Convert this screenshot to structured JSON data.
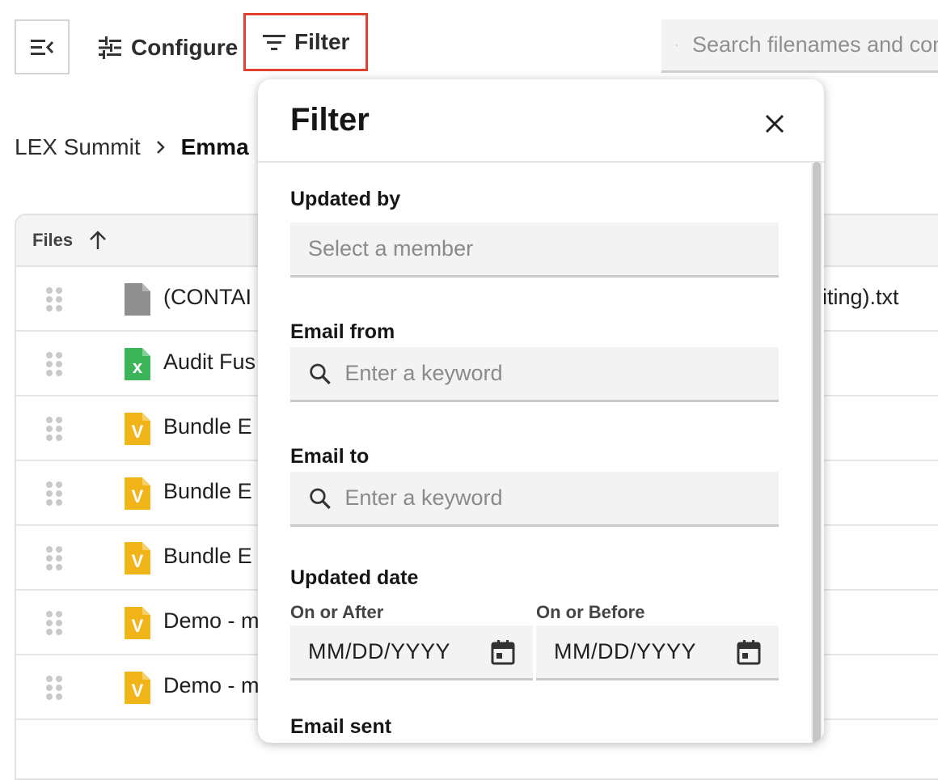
{
  "toolbar": {
    "configure_label": "Configure",
    "filter_label": "Filter",
    "search_placeholder": "Search filenames and content"
  },
  "breadcrumb": {
    "root": "LEX Summit",
    "current": "Emma"
  },
  "table": {
    "header": "Files",
    "rows": [
      {
        "type": "txt",
        "name": "(CONTAI",
        "name_right": "diting).txt"
      },
      {
        "type": "xlsx",
        "name": "Audit Fus",
        "name_right": ""
      },
      {
        "type": "v",
        "name": "Bundle E",
        "name_right": ""
      },
      {
        "type": "v",
        "name": "Bundle E",
        "name_right": ""
      },
      {
        "type": "v",
        "name": "Bundle E",
        "name_right": ""
      },
      {
        "type": "v",
        "name": "Demo - m",
        "name_right": ""
      },
      {
        "type": "v",
        "name": "Demo - m",
        "name_right": ""
      }
    ]
  },
  "filter_panel": {
    "title": "Filter",
    "updated_by": {
      "label": "Updated by",
      "placeholder": "Select a member"
    },
    "email_from": {
      "label": "Email from",
      "placeholder": "Enter a keyword"
    },
    "email_to": {
      "label": "Email to",
      "placeholder": "Enter a keyword"
    },
    "updated_date": {
      "label": "Updated date",
      "after_label": "On or After",
      "before_label": "On or Before",
      "after_value": "MM/DD/YYYY",
      "before_value": "MM/DD/YYYY"
    },
    "next_label": "Email sent"
  },
  "colors": {
    "highlight": "#e0402f",
    "xlsx_icon": "#3cb55a",
    "v_icon": "#f2b519",
    "txt_icon": "#8f8f8f"
  },
  "icons": {
    "menu": "collapse-menu-icon",
    "configure": "sliders-icon",
    "filter": "filter-lines-icon",
    "search": "search-list-icon",
    "sort": "arrow-up-icon",
    "close": "close-icon",
    "calendar": "calendar-icon",
    "drag": "drag-handle-icon"
  }
}
